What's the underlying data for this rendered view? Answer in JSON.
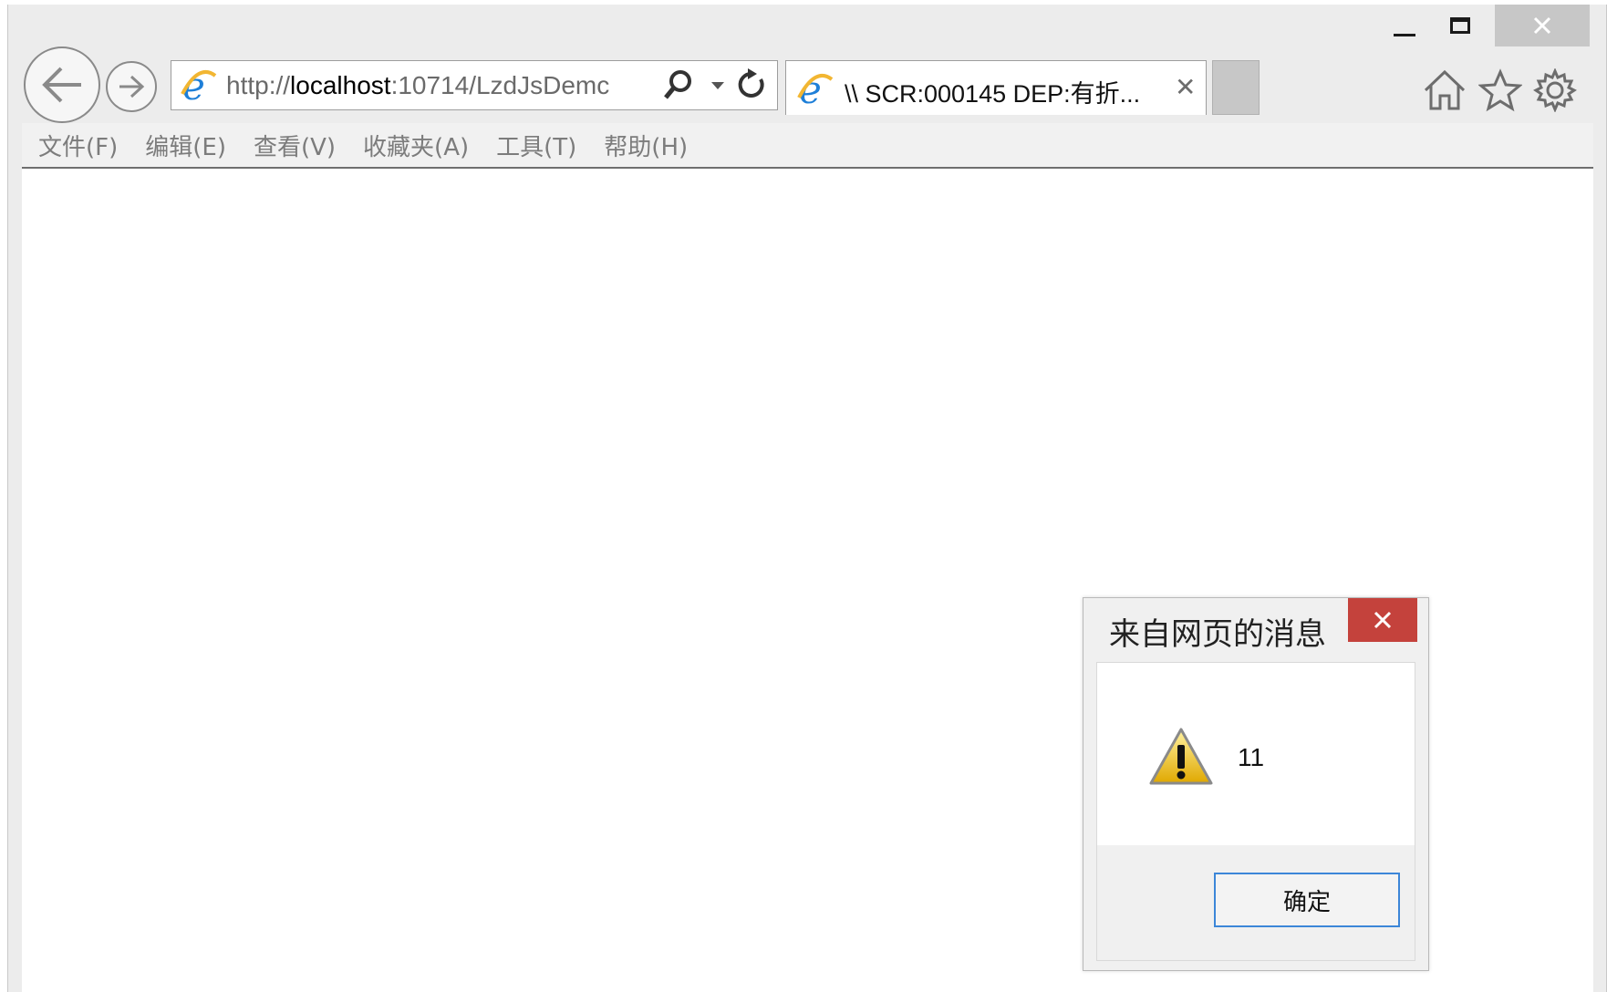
{
  "window": {
    "controls": {
      "minimize": "minimize",
      "maximize": "maximize",
      "close": "close"
    }
  },
  "address_bar": {
    "url_prefix": "http://",
    "url_host": "localhost",
    "url_rest": ":10714/LzdJsDemc"
  },
  "tab": {
    "title": "\\\\ SCR:000145 DEP:有折...",
    "close_glyph": "✕"
  },
  "menu": {
    "items": [
      "文件(F)",
      "编辑(E)",
      "查看(V)",
      "收藏夹(A)",
      "工具(T)",
      "帮助(H)"
    ]
  },
  "dialog": {
    "title": "来自网页的消息",
    "message": "11",
    "ok_label": "确定",
    "icon": "warning-icon"
  },
  "colors": {
    "dialog_close_bg": "#c4423c",
    "ok_border": "#3c86d8",
    "chrome_bg": "#ececec"
  }
}
